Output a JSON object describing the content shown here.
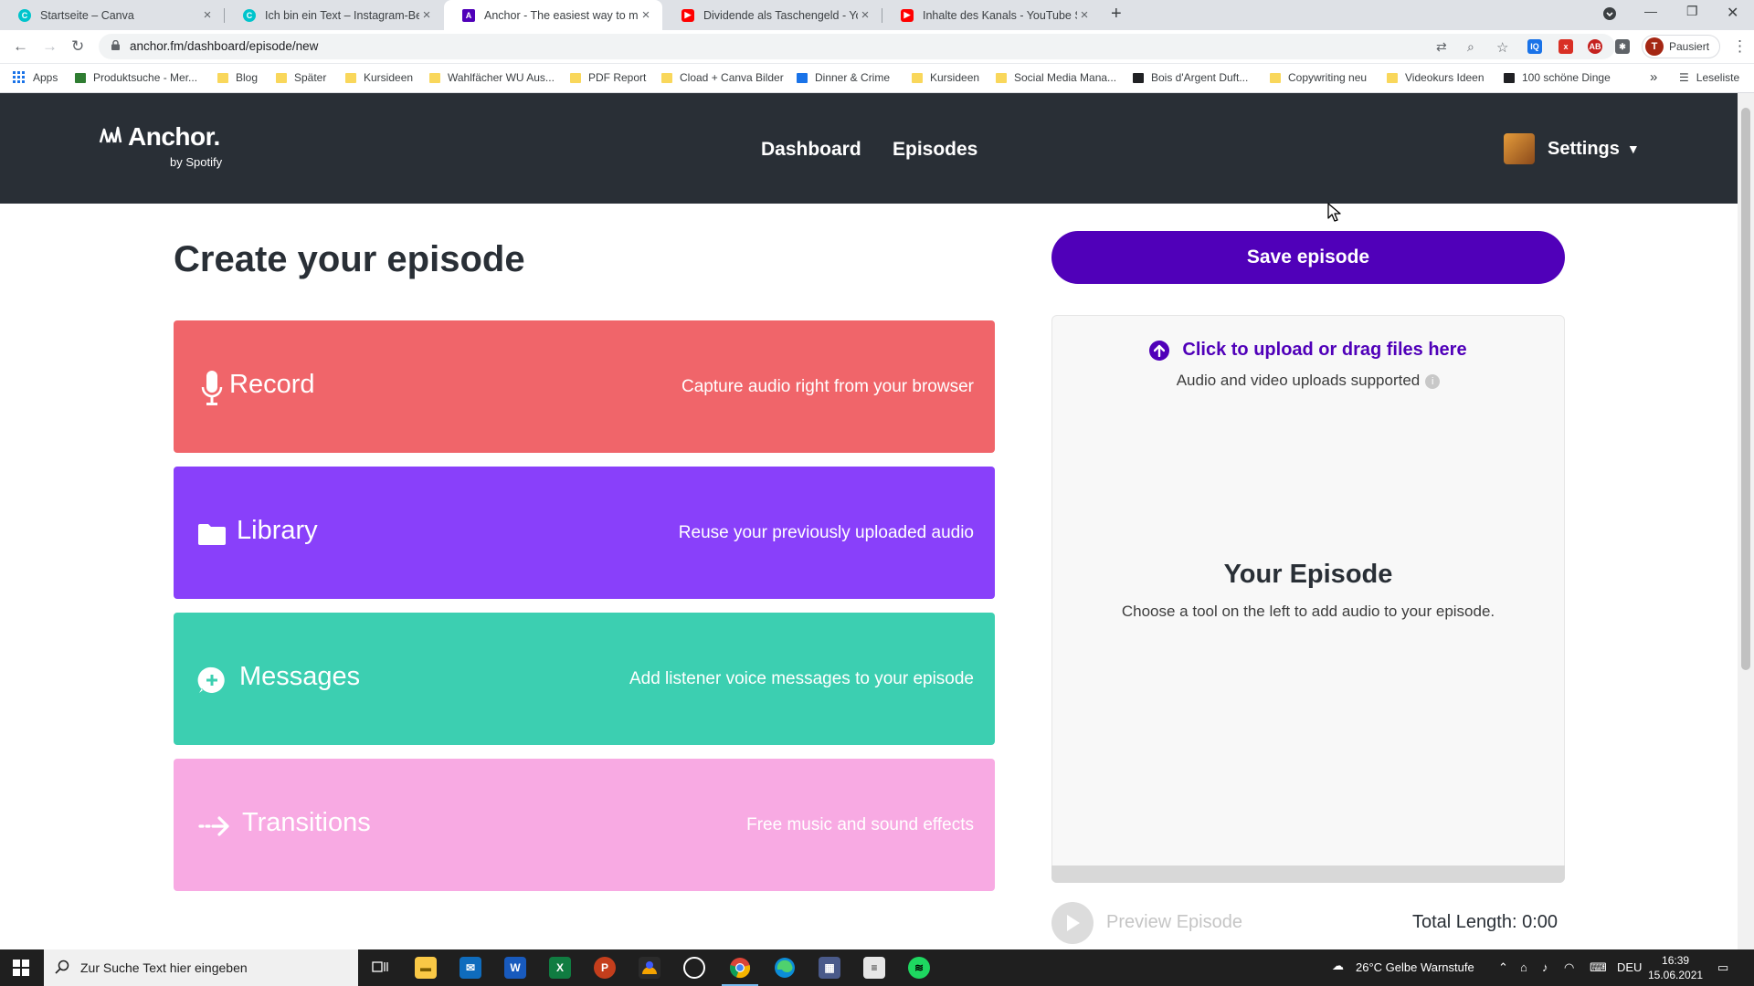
{
  "browser": {
    "tabs": [
      {
        "title": "Startseite – Canva",
        "favicon": "canva-icon",
        "color": "#00c4cc"
      },
      {
        "title": "Ich bin ein Text – Instagram-Beitr",
        "favicon": "canva-icon",
        "color": "#00c4cc"
      },
      {
        "title": "Anchor - The easiest way to mak",
        "favicon": "anchor-icon",
        "color": "#5000b9",
        "active": true
      },
      {
        "title": "Dividende als Taschengeld - You",
        "favicon": "youtube-icon",
        "color": "#ff0000"
      },
      {
        "title": "Inhalte des Kanals - YouTube Stu",
        "favicon": "youtube-icon",
        "color": "#ff0000"
      }
    ],
    "url": "anchor.fm/dashboard/episode/new",
    "profile_initial": "T",
    "profile_label": "Pausiert",
    "bookmarks": [
      {
        "label": "Apps",
        "icon": "apps-grid-icon"
      },
      {
        "label": "Produktsuche - Mer...",
        "icon": "merch-icon"
      },
      {
        "label": "Blog",
        "icon": "folder-icon"
      },
      {
        "label": "Später",
        "icon": "folder-icon"
      },
      {
        "label": "Kursideen",
        "icon": "folder-icon"
      },
      {
        "label": "Wahlfächer WU Aus...",
        "icon": "folder-icon"
      },
      {
        "label": "PDF Report",
        "icon": "folder-icon"
      },
      {
        "label": "Cload + Canva Bilder",
        "icon": "folder-icon"
      },
      {
        "label": "Dinner & Crime",
        "icon": "site-icon"
      },
      {
        "label": "Kursideen",
        "icon": "folder-icon"
      },
      {
        "label": "Social Media Mana...",
        "icon": "folder-icon"
      },
      {
        "label": "Bois d'Argent Duft...",
        "icon": "site-icon"
      },
      {
        "label": "Copywriting neu",
        "icon": "folder-icon"
      },
      {
        "label": "Videokurs Ideen",
        "icon": "folder-icon"
      },
      {
        "label": "100 schöne Dinge",
        "icon": "site-icon"
      }
    ],
    "bookmarks_overflow": "»",
    "reading_list": "Leseliste"
  },
  "anchor": {
    "logo": "Anchor.",
    "logo_sub": "by Spotify",
    "nav": {
      "dashboard": "Dashboard",
      "episodes": "Episodes"
    },
    "settings": "Settings"
  },
  "main": {
    "title": "Create your episode",
    "tools": {
      "record": {
        "name": "Record",
        "desc": "Capture audio right from your browser"
      },
      "library": {
        "name": "Library",
        "desc": "Reuse your previously uploaded audio"
      },
      "messages": {
        "name": "Messages",
        "desc": "Add listener voice messages to your episode"
      },
      "transitions": {
        "name": "Transitions",
        "desc": "Free music and sound effects"
      }
    }
  },
  "panel": {
    "save": "Save episode",
    "upload": "Click to upload or drag files here",
    "upload_sub": "Audio and video uploads supported",
    "episode_title": "Your Episode",
    "episode_sub": "Choose a tool on the left to add audio to your episode.",
    "preview": "Preview Episode",
    "total_length": "Total Length: 0:00"
  },
  "taskbar": {
    "search_placeholder": "Zur Suche Text hier eingeben",
    "weather": "26°C  Gelbe Warnstufe",
    "lang": "DEU",
    "time": "16:39",
    "date": "15.06.2021"
  },
  "colors": {
    "header": "#292f36",
    "record": "#f0656a",
    "library": "#8940fa",
    "messages": "#3ccfb1",
    "transitions": "#f8aae3",
    "brand": "#5000b9"
  }
}
